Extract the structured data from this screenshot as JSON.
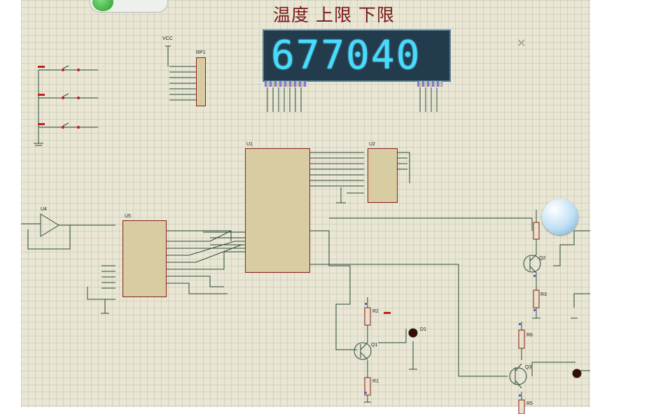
{
  "header": {
    "title": "温度 上限 下限"
  },
  "display": {
    "digits": "677040"
  },
  "components": {
    "u1": "U1",
    "u2": "U2",
    "u4": "U4",
    "u5": "U5",
    "rp1": "RP1",
    "q1": "Q1",
    "q2": "Q2",
    "q3": "Q3",
    "r1": "R1",
    "r2": "R2",
    "r3": "R3",
    "r5": "R5",
    "r6": "R6",
    "d1": "D1",
    "vcc": "VCC"
  },
  "colors": {
    "sheet": "#e9e6d4",
    "wire": "#2c4c3c",
    "chip_fill": "#d8cda2",
    "chip_border": "#8b1e1e",
    "title": "#7a1616",
    "display_bg": "#223c4d",
    "display_digits": "#46dcff"
  },
  "icons": {
    "bird": "proteus-bird-icon",
    "close": "close-x-icon",
    "toggle": "green-toggle-icon"
  }
}
